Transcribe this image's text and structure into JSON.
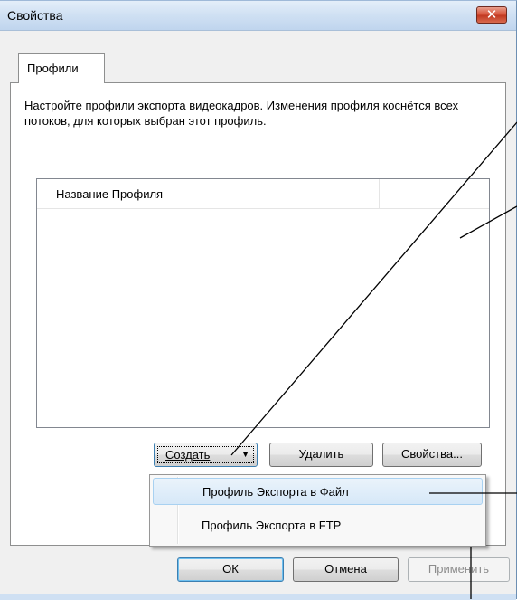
{
  "window": {
    "title": "Свойства"
  },
  "tabs": [
    {
      "label": "Профили"
    }
  ],
  "description": "Настройте профили экспорта видеокадров. Изменения профиля коснётся всех потоков, для которых выбран этот профиль.",
  "profiles_list": {
    "columns": [
      "Название Профиля",
      ""
    ],
    "rows": []
  },
  "buttons": {
    "create": "Создать",
    "delete": "Удалить",
    "properties": "Свойства...",
    "ok": "ОК",
    "cancel": "Отмена",
    "apply": "Применить"
  },
  "create_menu": {
    "items": [
      "Профиль Экспорта в Файл",
      "Профиль Экспорта в FTP"
    ],
    "highlighted_index": 0
  },
  "icons": {
    "close": "close-icon",
    "dropdown": "dropdown-arrow-icon"
  }
}
